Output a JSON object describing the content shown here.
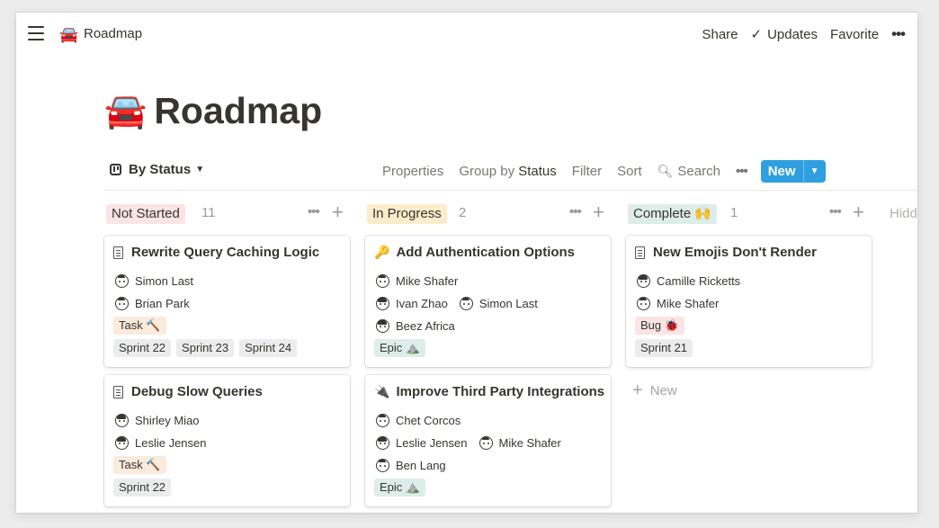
{
  "topbar": {
    "title_emoji": "🚘",
    "title": "Roadmap",
    "share": "Share",
    "updates": "Updates",
    "favorite": "Favorite",
    "more": "•••"
  },
  "page": {
    "emoji": "🚘",
    "title": "Roadmap"
  },
  "view": {
    "name": "By Status",
    "properties": "Properties",
    "group_by_prefix": "Group by",
    "group_by_value": "Status",
    "filter": "Filter",
    "sort": "Sort",
    "search": "Search",
    "more": "•••",
    "new": "New"
  },
  "colors": {
    "accent": "#2f9fe0",
    "not_started_bg": "#fbe4e4",
    "in_progress_bg": "#fbeccc",
    "complete_bg": "#ddedea",
    "task_bg": "#faebdd",
    "epic_bg": "#ddedea",
    "bug_bg": "#fbe4e4",
    "sprint_bg": "#ebeced"
  },
  "columns": [
    {
      "label": "Not Started",
      "count": "11"
    },
    {
      "label": "In Progress",
      "count": "2"
    },
    {
      "label": "Complete 🙌",
      "count": "1"
    }
  ],
  "hidden_label": "Hidde",
  "cards": [
    {
      "title": "Rewrite Query Caching Logic",
      "icon": "doc-icon",
      "people": [
        [
          "Simon Last"
        ],
        [
          "Brian Park"
        ]
      ],
      "type": "Task 🔨",
      "sprints": [
        "Sprint 22",
        "Sprint 23",
        "Sprint 24"
      ]
    },
    {
      "title": "Debug Slow Queries",
      "icon": "doc-icon",
      "people": [
        [
          "Shirley Miao"
        ],
        [
          "Leslie Jensen"
        ]
      ],
      "type": "Task 🔨",
      "sprints": [
        "Sprint 22"
      ]
    },
    {
      "title": "Add Authentication Options",
      "icon": "🔑",
      "people": [
        [
          "Mike Shafer"
        ],
        [
          "Ivan Zhao",
          "Simon Last"
        ],
        [
          "Beez Africa"
        ]
      ],
      "type": "Epic ⛰️",
      "sprints": []
    },
    {
      "title": "Improve Third Party Integrations",
      "icon": "🔌",
      "people": [
        [
          "Chet Corcos"
        ],
        [
          "Leslie Jensen",
          "Mike Shafer"
        ],
        [
          "Ben Lang"
        ]
      ],
      "type": "Epic ⛰️",
      "sprints": []
    },
    {
      "title": "New Emojis Don't Render",
      "icon": "doc-icon",
      "people": [
        [
          "Camille Ricketts"
        ],
        [
          "Mike Shafer"
        ]
      ],
      "type": "Bug 🐞",
      "sprints": [
        "Sprint 21"
      ]
    }
  ],
  "new_item": "New"
}
